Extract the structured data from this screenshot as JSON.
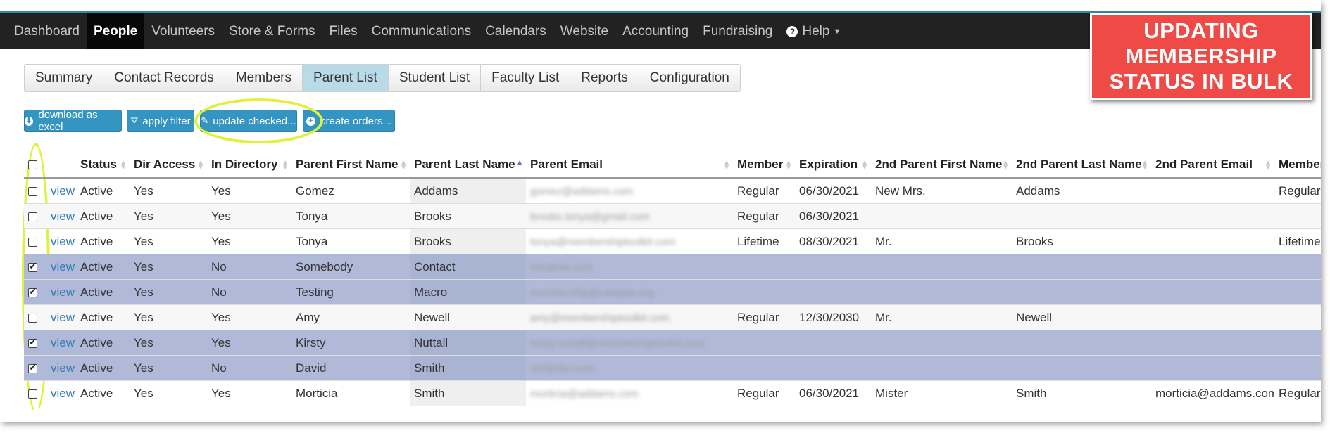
{
  "nav": {
    "items": [
      "Dashboard",
      "People",
      "Volunteers",
      "Store & Forms",
      "Files",
      "Communications",
      "Calendars",
      "Website",
      "Accounting",
      "Fundraising"
    ],
    "active": "People",
    "help_label": "Help"
  },
  "callout": {
    "lines": [
      "UPDATING",
      "MEMBERSHIP",
      "STATUS IN BULK"
    ],
    "color": "#f04a46"
  },
  "tabs": {
    "items": [
      "Summary",
      "Contact Records",
      "Members",
      "Parent List",
      "Student List",
      "Faculty List",
      "Reports",
      "Configuration"
    ],
    "active": "Parent List"
  },
  "buttons": {
    "download": "download as excel",
    "filter": "apply filter",
    "update": "update checked...",
    "orders": "create orders...",
    "color": "#3495c2"
  },
  "highlight_color": "#dff13a",
  "table": {
    "columns": [
      "Status",
      "Dir Access",
      "In Directory",
      "Parent First Name",
      "Parent Last Name",
      "Parent Email",
      "Member",
      "Expiration",
      "2nd Parent First Name",
      "2nd Parent Last Name",
      "2nd Parent Email",
      "Member"
    ],
    "view_label": "view",
    "rows": [
      {
        "checked": false,
        "status": "Active",
        "dir_access": "Yes",
        "in_directory": "Yes",
        "first": "Gomez",
        "last": "Addams",
        "email": "gomez@addams.com",
        "member": "Regular",
        "expiration": "06/30/2021",
        "p2_first": "New Mrs.",
        "p2_last": "Addams",
        "p2_email": "",
        "p2_member": "Regular"
      },
      {
        "checked": false,
        "status": "Active",
        "dir_access": "Yes",
        "in_directory": "Yes",
        "first": "Tonya",
        "last": "Brooks",
        "email": "brooks.tonya@gmail.com",
        "member": "Regular",
        "expiration": "06/30/2021",
        "p2_first": "",
        "p2_last": "",
        "p2_email": "",
        "p2_member": ""
      },
      {
        "checked": false,
        "status": "Active",
        "dir_access": "Yes",
        "in_directory": "Yes",
        "first": "Tonya",
        "last": "Brooks",
        "email": "tonya@membershiptoolkit.com",
        "member": "Lifetime",
        "expiration": "08/30/2021",
        "p2_first": "Mr.",
        "p2_last": "Brooks",
        "p2_email": "",
        "p2_member": "Lifetime"
      },
      {
        "checked": true,
        "status": "Active",
        "dir_access": "Yes",
        "in_directory": "No",
        "first": "Somebody",
        "last": "Contact",
        "email": "me@me.com",
        "member": "",
        "expiration": "",
        "p2_first": "",
        "p2_last": "",
        "p2_email": "",
        "p2_member": ""
      },
      {
        "checked": true,
        "status": "Active",
        "dir_access": "Yes",
        "in_directory": "No",
        "first": "Testing",
        "last": "Macro",
        "email": "membership@cakepta.org",
        "member": "",
        "expiration": "",
        "p2_first": "",
        "p2_last": "",
        "p2_email": "",
        "p2_member": ""
      },
      {
        "checked": false,
        "status": "Active",
        "dir_access": "Yes",
        "in_directory": "Yes",
        "first": "Amy",
        "last": "Newell",
        "email": "amy@membershiptoolkit.com",
        "member": "Regular",
        "expiration": "12/30/2030",
        "p2_first": "Mr.",
        "p2_last": "Newell",
        "p2_email": "",
        "p2_member": ""
      },
      {
        "checked": true,
        "status": "Active",
        "dir_access": "Yes",
        "in_directory": "Yes",
        "first": "Kirsty",
        "last": "Nuttall",
        "email": "kirsty.nuttall@membershiptoolkit.com",
        "member": "",
        "expiration": "",
        "p2_first": "",
        "p2_last": "",
        "p2_email": "",
        "p2_member": ""
      },
      {
        "checked": true,
        "status": "Active",
        "dir_access": "Yes",
        "in_directory": "No",
        "first": "David",
        "last": "Smith",
        "email": "dsf@abc.com",
        "member": "",
        "expiration": "",
        "p2_first": "",
        "p2_last": "",
        "p2_email": "",
        "p2_member": ""
      },
      {
        "checked": false,
        "status": "Active",
        "dir_access": "Yes",
        "in_directory": "Yes",
        "first": "Morticia",
        "last": "Smith",
        "email": "morticia@addams.com",
        "member": "Regular",
        "expiration": "06/30/2021",
        "p2_first": "Mister",
        "p2_last": "Smith",
        "p2_email": "morticia@addams.com",
        "p2_member": "Regular"
      }
    ]
  }
}
